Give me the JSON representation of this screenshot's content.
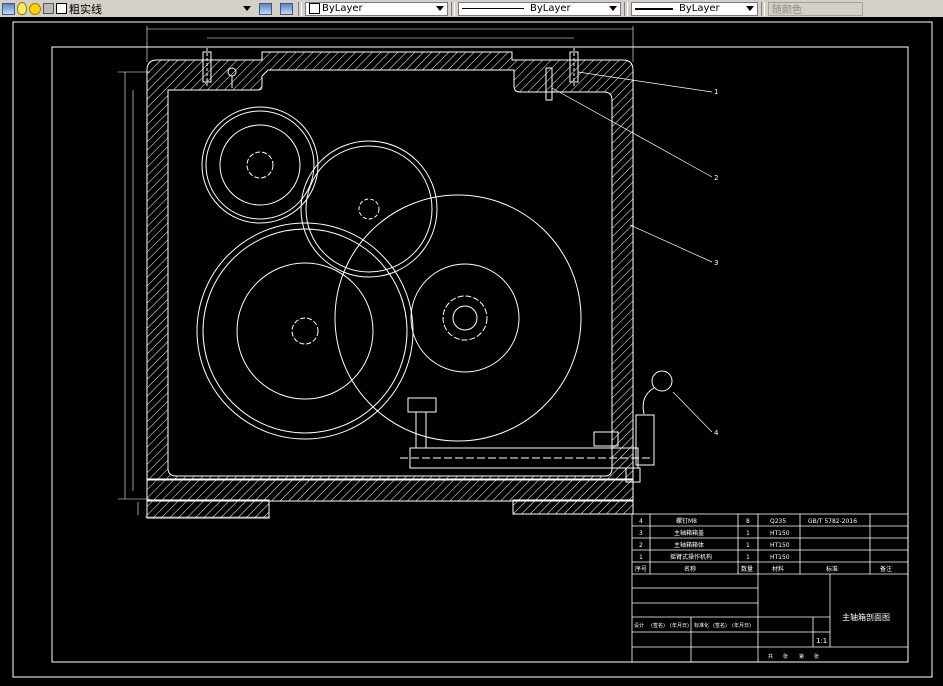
{
  "toolbar": {
    "layer_name": "粗实线",
    "color_value": "ByLayer",
    "linetype_value": "ByLayer",
    "lineweight_value": "ByLayer",
    "plotstyle_value": "随颜色"
  },
  "drawing": {
    "leader_labels": [
      "1",
      "2",
      "3",
      "4"
    ],
    "scale": "1:1"
  },
  "title_block": {
    "drawing_title": "主轴箱剖面图",
    "header": {
      "no": "序号",
      "name": "名称",
      "qty": "数量",
      "material": "材料",
      "standard": "标准",
      "note": "备注"
    },
    "parts": [
      {
        "no": "4",
        "name": "螺钉M8",
        "qty": "8",
        "material": "Q235",
        "standard": "GB/T 5782-2016",
        "note": ""
      },
      {
        "no": "3",
        "name": "主轴箱箱盖",
        "qty": "1",
        "material": "HT150",
        "standard": "",
        "note": ""
      },
      {
        "no": "2",
        "name": "主轴箱箱体",
        "qty": "1",
        "material": "HT150",
        "standard": "",
        "note": ""
      },
      {
        "no": "1",
        "name": "摇臂式操作机构",
        "qty": "1",
        "material": "HT150",
        "standard": "",
        "note": ""
      }
    ],
    "sign_row": [
      "设计",
      "(签名)",
      "(年月日)",
      "标准化",
      "(签名)",
      "(年月日)"
    ],
    "bottom_row": [
      "共",
      "张",
      "第",
      "张"
    ]
  }
}
